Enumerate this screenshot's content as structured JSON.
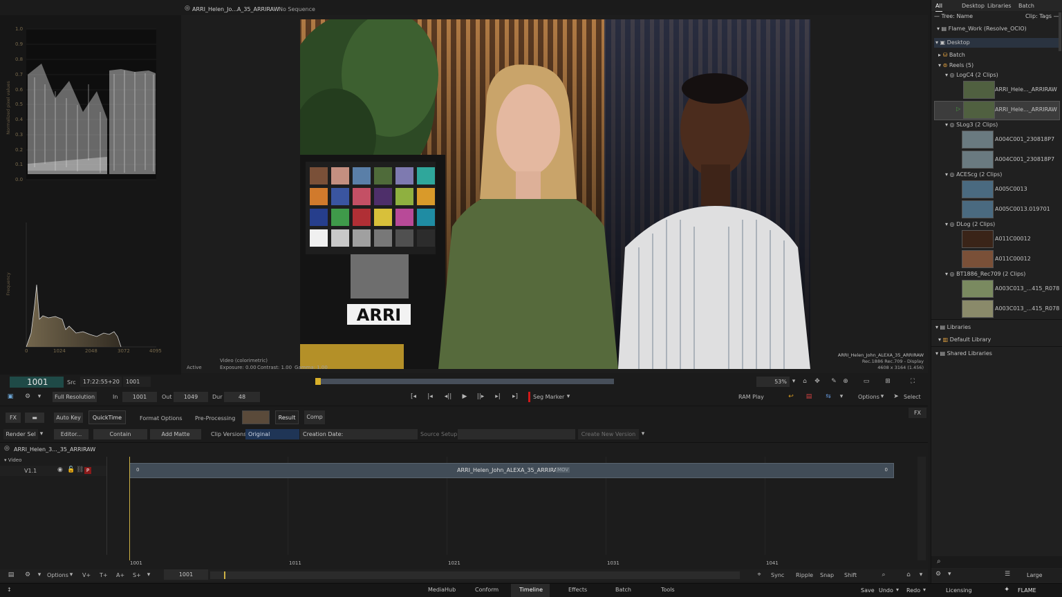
{
  "viewer": {
    "clip_tab": "ARRI_Helen_Jo...A_35_ARRIRAW",
    "sequence_tab": "No Sequence",
    "status": "Active",
    "video_mode": "Video (colorimetric)",
    "exposure": "Exposure: 0.00",
    "contrast": "Contrast: 1.00",
    "gamma": "Gamma: 1.00",
    "info_name": "ARRI_Helen_John_ALEXA_35_ARRIRAW",
    "info_space": "Rec.1886 Rec.709 - Display",
    "info_res": "4608 x 3164 (1.456)",
    "chart_text": "ARRI",
    "zoom": "53%"
  },
  "scopes": {
    "waveform_ylabel": "Normalized pixel values",
    "waveform_ticks": [
      "1.0",
      "0.9",
      "0.8",
      "0.7",
      "0.6",
      "0.5",
      "0.4",
      "0.3",
      "0.2",
      "0.1",
      "0.0"
    ],
    "histo_ylabel": "Frequency",
    "histo_ticks": [
      "0",
      "1024",
      "2048",
      "3072",
      "4095"
    ]
  },
  "transport": {
    "frame": "1001",
    "src_label": "Src",
    "timecode": "17:22:55+20",
    "src_frame": "1001",
    "full_res": "Full Resolution",
    "in_label": "In",
    "in_value": "1001",
    "out_label": "Out",
    "out_value": "1049",
    "dur_label": "Dur",
    "dur_value": "48",
    "seg_marker": "Seg Marker",
    "ram_play": "RAM Play",
    "options": "Options",
    "select": "Select"
  },
  "tools": {
    "fx": "FX",
    "auto_key": "Auto Key",
    "quicktime": "QuickTime",
    "format_options": "Format Options",
    "pre_processing": "Pre-Processing",
    "result": "Result",
    "comp": "Comp",
    "fx_right": "FX",
    "render_sel": "Render Sel",
    "editor": "Editor...",
    "contain": "Contain",
    "add_matte": "Add Matte",
    "clip_versions": "Clip Versions",
    "version_value": "Original",
    "creation_date": "Creation Date:",
    "source_setup": "Source Setup",
    "create_new_version": "Create New Version"
  },
  "timeline": {
    "clip_title": "ARRI_Helen_3..._35_ARRIRAW",
    "video_label": "Video",
    "track_label": "V1.1",
    "segment_name": "ARRI_Helen_John_ALEXA_35_ARRIRAW",
    "segment_badge": "MOV",
    "seg_start": "0",
    "seg_end": "0",
    "ruler": [
      "1001",
      "1011",
      "1021",
      "1031",
      "1041"
    ],
    "current_frame": "1001",
    "p_badge": "P"
  },
  "bottom": {
    "options": "Options",
    "v_plus": "V+",
    "t_plus": "T+",
    "a_plus": "A+",
    "s_plus": "S+",
    "sync": "Sync",
    "ripple": "Ripple",
    "snap": "Snap",
    "shift": "Shift",
    "large": "Large"
  },
  "footer": {
    "tabs": [
      "MediaHub",
      "Conform",
      "Timeline",
      "Effects",
      "Batch",
      "Tools"
    ],
    "active_tab": "Timeline",
    "save": "Save",
    "undo": "Undo",
    "redo": "Redo",
    "licensing": "Licensing",
    "brand": "FLAME"
  },
  "mediahub": {
    "tabs": [
      "All",
      "Desktop",
      "Libraries",
      "Batch"
    ],
    "tree_name": "Tree: Name",
    "clip_tags": "Clip: Tags",
    "project": "Flame_Work (Resolve_OCIO)",
    "desktop": "Desktop",
    "batch": "Batch",
    "reels": "Reels (5)",
    "groups": [
      {
        "name": "LogC4 (2 Clips)",
        "clips": [
          "ARRI_Hele..._ARRIRAW",
          "ARRI_Hele..._ARRIRAW"
        ]
      },
      {
        "name": "SLog3 (2 Clips)",
        "clips": [
          "A004C001_230818P7",
          "A004C001_230818P7"
        ]
      },
      {
        "name": "ACEScg (2 Clips)",
        "clips": [
          "A005C0013",
          "A005C0013.019701"
        ]
      },
      {
        "name": "DLog (2 Clips)",
        "clips": [
          "A011C00012",
          "A011C00012"
        ]
      },
      {
        "name": "BT1886_Rec709 (2 Clips)",
        "clips": [
          "A003C013_...415_R078",
          "A003C013_...415_R078"
        ]
      }
    ],
    "libraries": "Libraries",
    "default_library": "Default Library",
    "shared_libraries": "Shared Libraries"
  },
  "colors": {
    "accent_teal": "#1f5a55",
    "highlight_yellow": "#c8a020",
    "playhead": "#cdb144",
    "chart_patches": [
      "#7a5038",
      "#c48f80",
      "#5a7fa8",
      "#4f6b3a",
      "#7e7ab0",
      "#2fa79b",
      "#d17a2c",
      "#3a55a0",
      "#c45065",
      "#4e2f6a",
      "#8fb040",
      "#d99a2a",
      "#263e8c",
      "#3f9a4a",
      "#b02f35",
      "#d8c03a",
      "#b84a98",
      "#1f8ca3",
      "#f0f0f0",
      "#c8c8c8",
      "#a0a0a0",
      "#787878",
      "#505050",
      "#2c2c2c"
    ]
  }
}
